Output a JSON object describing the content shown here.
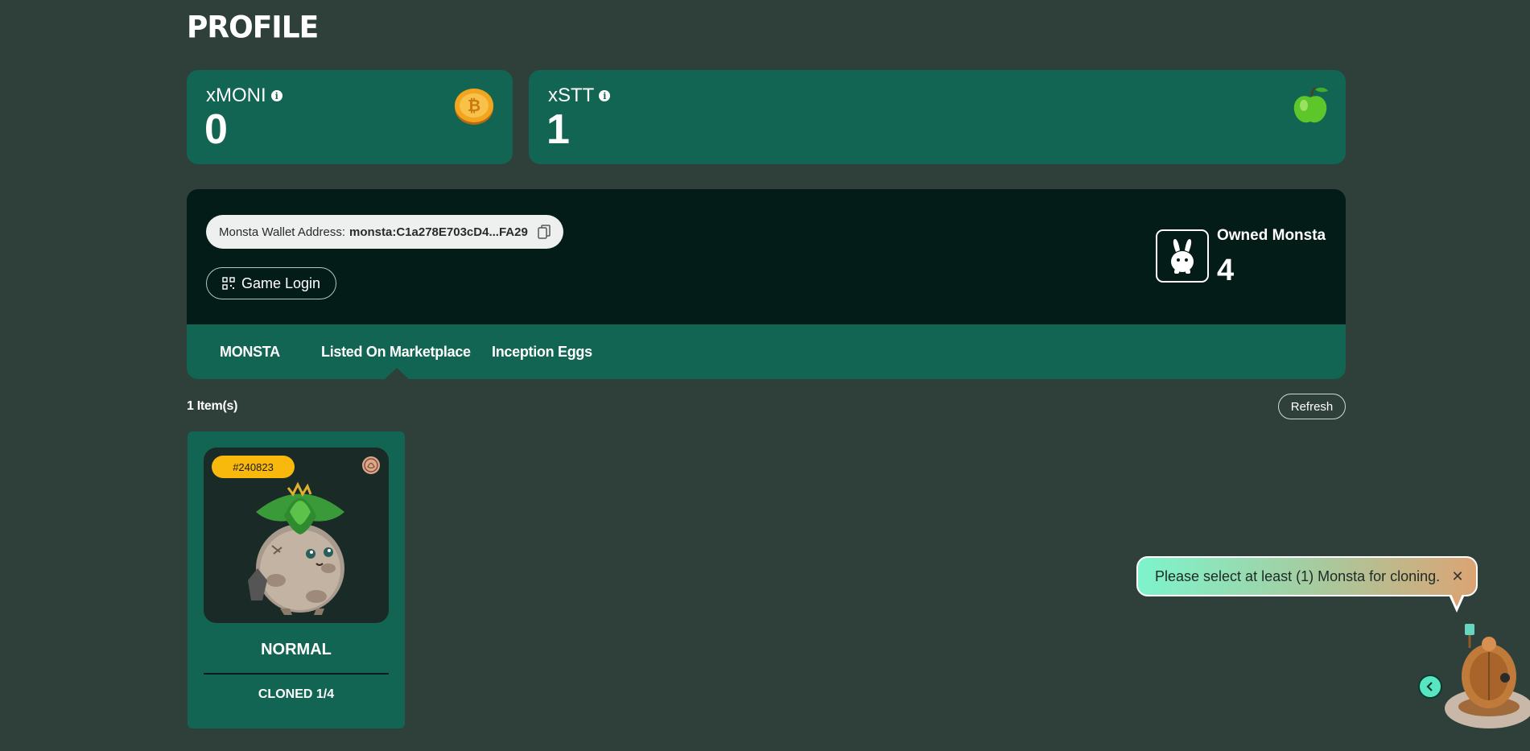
{
  "page": {
    "title": "PROFILE"
  },
  "stats": {
    "moni": {
      "label": "xMONI",
      "value": "0",
      "icon": "coin-icon"
    },
    "stt": {
      "label": "xSTT",
      "value": "1",
      "icon": "apple-icon"
    }
  },
  "wallet": {
    "label": "Monsta Wallet Address:",
    "address": "monsta:C1a278E703cD4...FA29",
    "game_login_label": "Game Login"
  },
  "owned": {
    "label": "Owned Monsta",
    "value": "4"
  },
  "tabs": [
    {
      "label": "MONSTA"
    },
    {
      "label": "Listed On Marketplace",
      "active": true
    },
    {
      "label": "Inception Eggs"
    }
  ],
  "list": {
    "count_label": "1 Item(s)",
    "refresh_label": "Refresh",
    "items": [
      {
        "id": "#240823",
        "rarity": "NORMAL",
        "cloned": "CLONED 1/4"
      }
    ]
  },
  "toast": {
    "message": "Please select at least (1) Monsta for cloning.",
    "close_glyph": "✕"
  },
  "colors": {
    "background": "#2f403b",
    "card": "#126453",
    "panel": "#041c17",
    "badge": "#f8b90c"
  }
}
